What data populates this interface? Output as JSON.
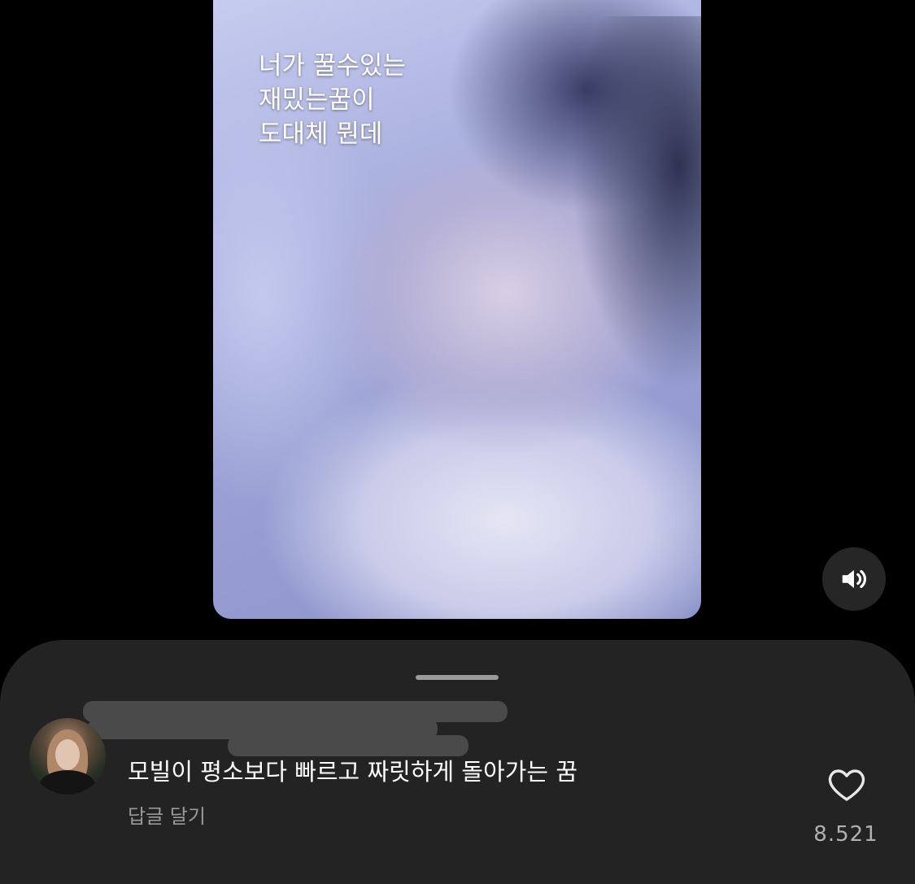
{
  "media": {
    "caption": "너가 꿀수있는\n재밌는꿈이\n도대체 뭔데"
  },
  "controls": {
    "sound_icon": "speaker-volume-icon"
  },
  "comment": {
    "text": "모빌이 평소보다 빠르고 짜릿하게 돌아가는 꿈",
    "reply_label": "답글 달기",
    "like_icon": "heart-outline-icon",
    "like_count": "8.521"
  },
  "colors": {
    "background": "#000000",
    "sheet": "#232323",
    "secondary_text": "#9a9a9a"
  }
}
